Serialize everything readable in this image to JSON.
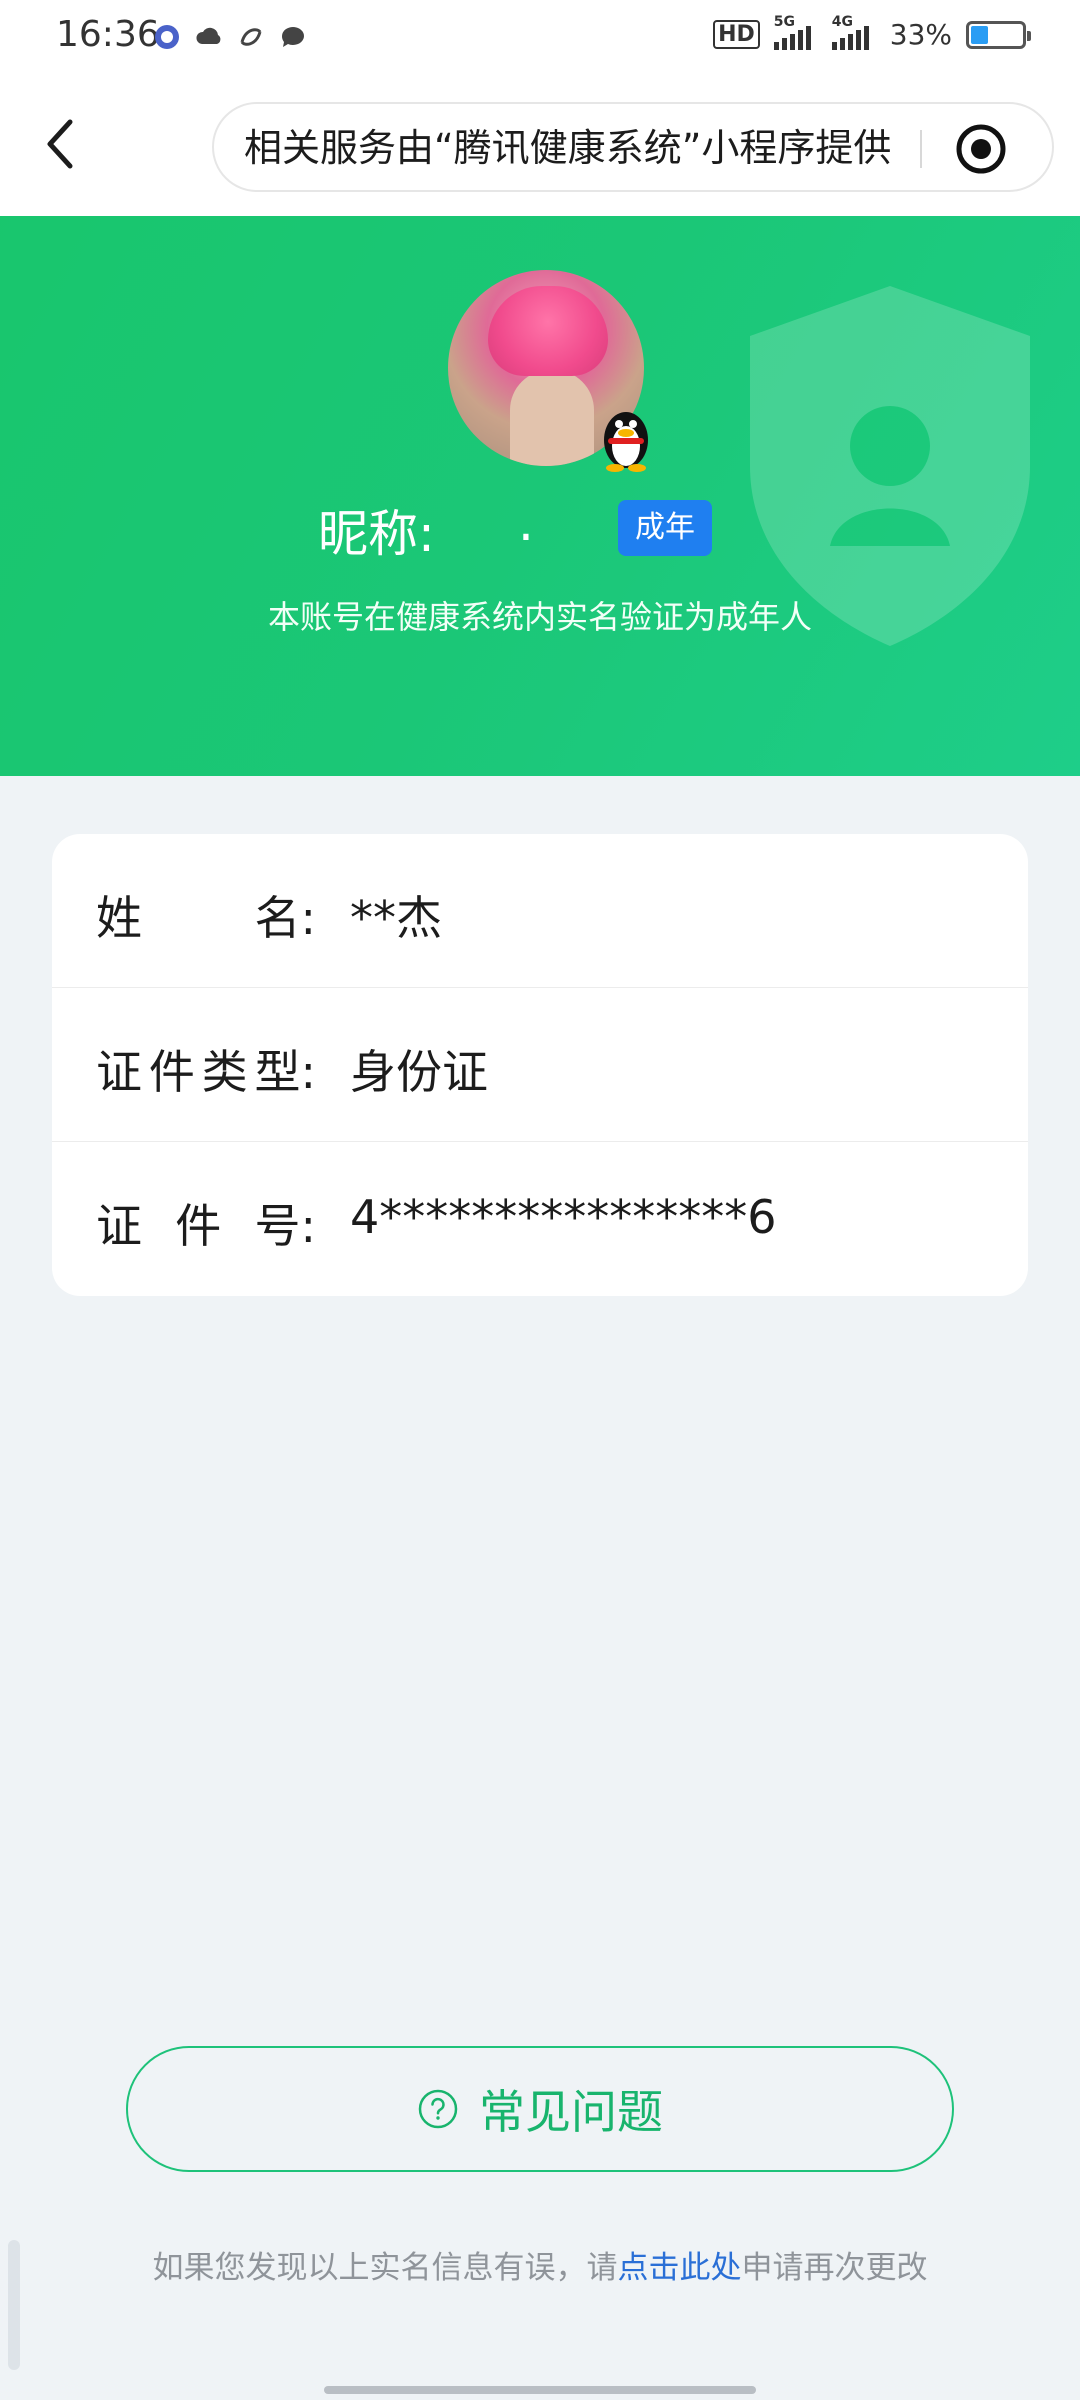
{
  "status_bar": {
    "time": "16:36",
    "hd_label": "HD",
    "net1_label": "5G",
    "net2_label": "4G",
    "battery_text": "33%",
    "battery_level": 0.33,
    "left_icons": [
      "app-notification-icon",
      "cloud-icon",
      "sync-icon",
      "chat-bubble-icon"
    ]
  },
  "nav": {
    "title": "相关服务由“腾讯健康系统”小程序提供"
  },
  "profile": {
    "nickname_label": "昵称:",
    "nickname_value": ".",
    "age_badge": "成年",
    "description": "本账号在健康系统内实名验证为成年人"
  },
  "info": {
    "rows": [
      {
        "key_chars": [
          "姓",
          "名:"
        ],
        "value": "**杰"
      },
      {
        "key_chars": [
          "证",
          "件",
          "类",
          "型:"
        ],
        "value": "身份证"
      },
      {
        "key_chars": [
          "证",
          "件",
          "号:"
        ],
        "value": "4****************6"
      }
    ]
  },
  "faq": {
    "label": "常见问题"
  },
  "footer": {
    "before": "如果您发现以上实名信息有误，请",
    "link": "点击此处",
    "after": "申请再次更改"
  },
  "colors": {
    "green": "#1bc777",
    "badge_blue": "#1f7ff0",
    "link_blue": "#2a6fd6"
  }
}
